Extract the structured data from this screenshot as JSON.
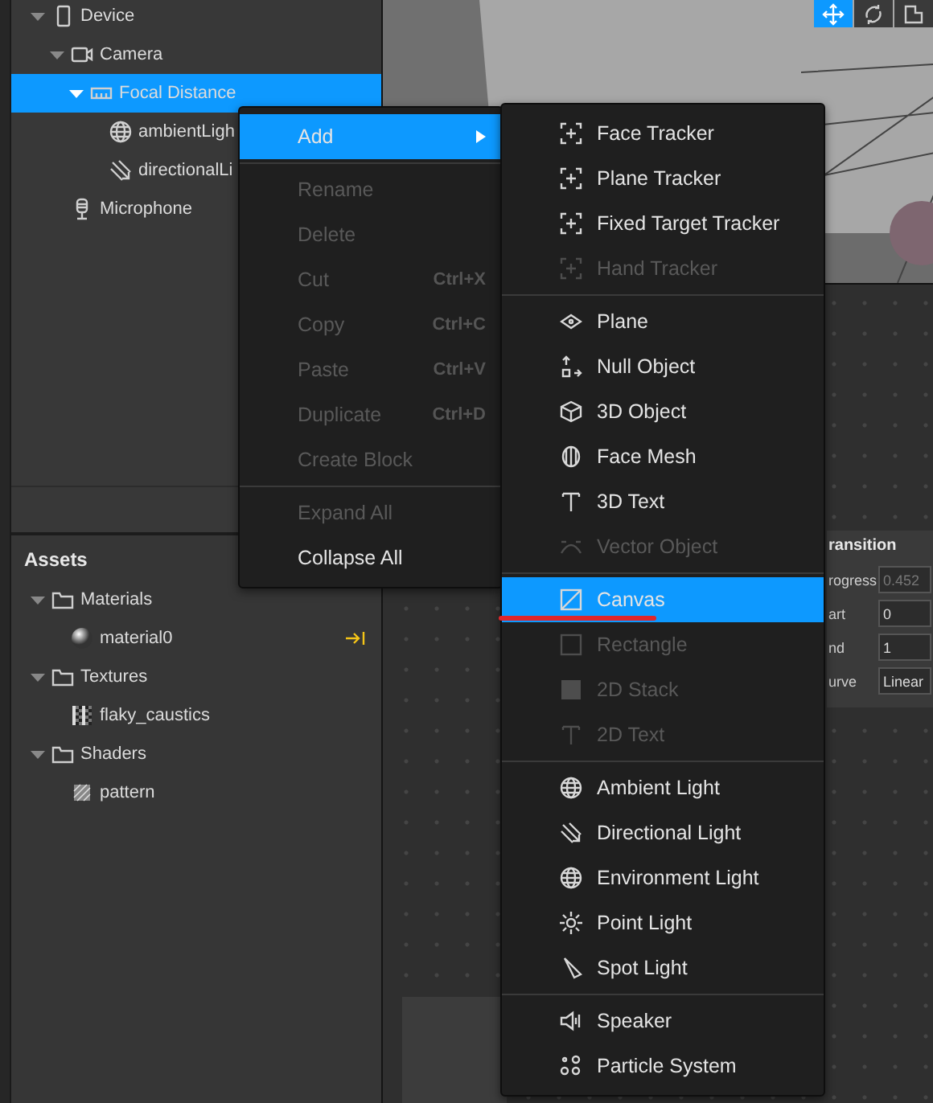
{
  "toolbar": [
    {
      "kind": "move",
      "selected": true
    },
    {
      "kind": "rotate",
      "selected": false
    },
    {
      "kind": "scale",
      "selected": false
    }
  ],
  "scene_tree": [
    {
      "label": "Device",
      "kind": "device",
      "expanded": true,
      "selected": false,
      "children": [
        {
          "label": "Camera",
          "kind": "camera",
          "expanded": true,
          "selected": false,
          "children": [
            {
              "label": "Focal Distance",
              "kind": "ruler",
              "expanded": true,
              "selected": true,
              "children": [
                {
                  "label": "ambientLigh",
                  "kind": "globe",
                  "selected": false
                },
                {
                  "label": "directionalLi",
                  "kind": "directional",
                  "selected": false
                }
              ]
            }
          ]
        },
        {
          "label": "Microphone",
          "kind": "mic",
          "selected": false
        }
      ]
    }
  ],
  "assets": {
    "title": "Assets",
    "items": [
      {
        "label": "Materials",
        "kind": "folder",
        "expanded": true,
        "children": [
          {
            "label": "material0",
            "kind": "sphere",
            "linked": true
          }
        ]
      },
      {
        "label": "Textures",
        "kind": "folder",
        "expanded": true,
        "children": [
          {
            "label": "flaky_caustics",
            "kind": "noise"
          }
        ]
      },
      {
        "label": "Shaders",
        "kind": "folder",
        "expanded": true,
        "children": [
          {
            "label": "pattern",
            "kind": "hatch"
          }
        ]
      }
    ]
  },
  "properties": {
    "title": "ransition",
    "rows": [
      {
        "label": "rogress",
        "value": "0.452",
        "disabled": true
      },
      {
        "label": "art",
        "value": "0",
        "disabled": false
      },
      {
        "label": "nd",
        "value": "1",
        "disabled": false
      },
      {
        "label": "urve",
        "value": "Linear",
        "disabled": false
      }
    ]
  },
  "context_menu": {
    "groups": [
      [
        {
          "label": "Add",
          "submenu": true,
          "selected": true,
          "disabled": false
        }
      ],
      [
        {
          "label": "Rename",
          "disabled": true,
          "selected": false
        },
        {
          "label": "Delete",
          "disabled": true,
          "selected": false
        },
        {
          "label": "Cut",
          "shortcut": "Ctrl+X",
          "disabled": true,
          "selected": false
        },
        {
          "label": "Copy",
          "shortcut": "Ctrl+C",
          "disabled": true,
          "selected": false
        },
        {
          "label": "Paste",
          "shortcut": "Ctrl+V",
          "disabled": true,
          "selected": false
        },
        {
          "label": "Duplicate",
          "shortcut": "Ctrl+D",
          "disabled": true,
          "selected": false
        },
        {
          "label": "Create Block",
          "disabled": true,
          "selected": false
        }
      ],
      [
        {
          "label": "Expand All",
          "disabled": true,
          "selected": false
        },
        {
          "label": "Collapse All",
          "disabled": false,
          "selected": false
        }
      ]
    ]
  },
  "add_submenu": {
    "groups": [
      [
        {
          "label": "Face Tracker",
          "kind": "tracker",
          "disabled": false,
          "selected": false
        },
        {
          "label": "Plane Tracker",
          "kind": "tracker",
          "disabled": false,
          "selected": false
        },
        {
          "label": "Fixed Target Tracker",
          "kind": "tracker",
          "disabled": false,
          "selected": false
        },
        {
          "label": "Hand Tracker",
          "kind": "tracker",
          "disabled": true,
          "selected": false
        }
      ],
      [
        {
          "label": "Plane",
          "kind": "plane",
          "disabled": false,
          "selected": false
        },
        {
          "label": "Null Object",
          "kind": "null",
          "disabled": false,
          "selected": false
        },
        {
          "label": "3D Object",
          "kind": "cube",
          "disabled": false,
          "selected": false
        },
        {
          "label": "Face Mesh",
          "kind": "mesh",
          "disabled": false,
          "selected": false
        },
        {
          "label": "3D Text",
          "kind": "text",
          "disabled": false,
          "selected": false
        },
        {
          "label": "Vector Object",
          "kind": "vector",
          "disabled": true,
          "selected": false
        }
      ],
      [
        {
          "label": "Canvas",
          "kind": "canvas",
          "disabled": false,
          "selected": true,
          "underlined": true
        },
        {
          "label": "Rectangle",
          "kind": "rect",
          "disabled": true,
          "selected": false
        },
        {
          "label": "2D Stack",
          "kind": "stack",
          "disabled": true,
          "selected": false
        },
        {
          "label": "2D Text",
          "kind": "text",
          "disabled": true,
          "selected": false
        }
      ],
      [
        {
          "label": "Ambient Light",
          "kind": "globe",
          "disabled": false,
          "selected": false
        },
        {
          "label": "Directional Light",
          "kind": "directional",
          "disabled": false,
          "selected": false
        },
        {
          "label": "Environment Light",
          "kind": "globe",
          "disabled": false,
          "selected": false
        },
        {
          "label": "Point Light",
          "kind": "point",
          "disabled": false,
          "selected": false
        },
        {
          "label": "Spot Light",
          "kind": "spot",
          "disabled": false,
          "selected": false
        }
      ],
      [
        {
          "label": "Speaker",
          "kind": "speaker",
          "disabled": false,
          "selected": false
        },
        {
          "label": "Particle System",
          "kind": "particles",
          "disabled": false,
          "selected": false
        }
      ]
    ]
  }
}
